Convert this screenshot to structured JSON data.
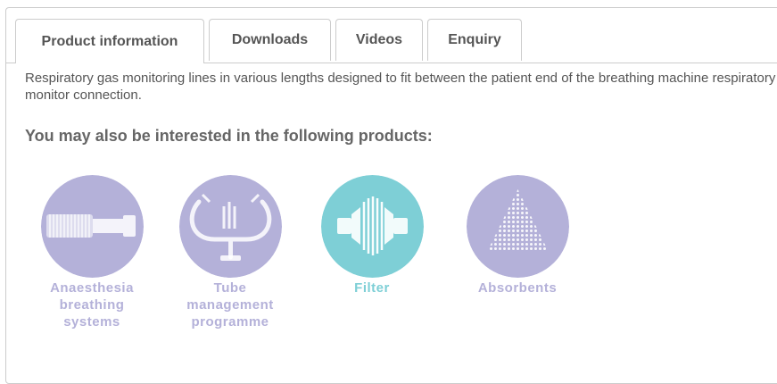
{
  "tabs": [
    {
      "label": "Product information",
      "active": true
    },
    {
      "label": "Downloads"
    },
    {
      "label": "Videos"
    },
    {
      "label": "Enquiry"
    }
  ],
  "description": "Respiratory gas monitoring lines in various lengths designed to fit between the patient end of the breathing machine respiratory gas monitor connection.",
  "related_heading": "You may also be interested in the following products:",
  "related_products": [
    {
      "line1": "Anaesthesia",
      "line2": "breathing",
      "line3": "systems",
      "color": "#b4b1d9",
      "icon": "breathing-tube-icon"
    },
    {
      "line1": "Tube",
      "line2": "management",
      "line3": "programme",
      "color": "#b4b1d9",
      "icon": "tube-holder-icon"
    },
    {
      "line1": "Filter",
      "line2": "",
      "line3": "",
      "color": "#7ecfd6",
      "icon": "filter-icon"
    },
    {
      "line1": "Absorbents",
      "line2": "",
      "line3": "",
      "color": "#b4b1d9",
      "icon": "absorbent-triangle-icon"
    }
  ],
  "colors": {
    "purple": "#b4b1d9",
    "teal": "#7ecfd6",
    "border": "#cccccc"
  }
}
